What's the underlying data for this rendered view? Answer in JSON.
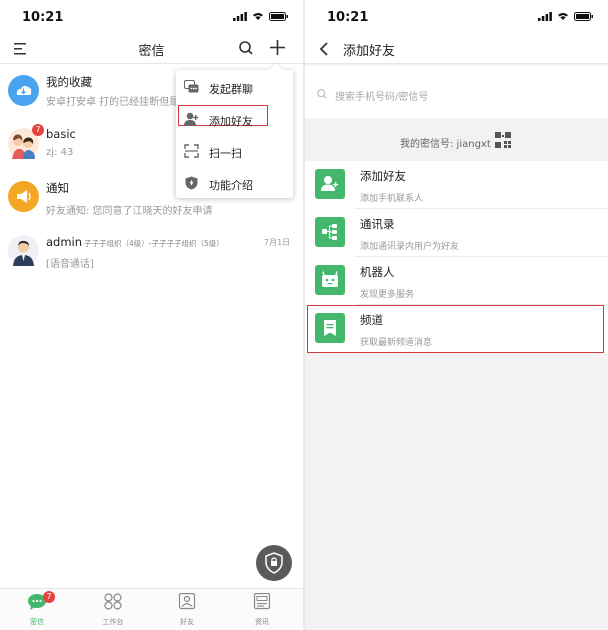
{
  "left": {
    "status": {
      "time": "10:21"
    },
    "nav": {
      "title": "密信"
    },
    "chats": [
      {
        "name": "我的收藏",
        "preview": "安卓打安卓 打的已经挂断但是",
        "meta": ""
      },
      {
        "name": "basic",
        "preview": "zj: 43",
        "meta": "",
        "badge": "7"
      },
      {
        "name": "通知",
        "preview": "好友通知: 您同意了江晓天的好友申请",
        "meta": ""
      },
      {
        "name": "admin",
        "org": "子子子组织（4级）-子子子子组织（5级）",
        "preview": "[语音通话]",
        "meta": "7月1日"
      }
    ],
    "menu": [
      {
        "label": "发起群聊",
        "icon": "group-chat-icon"
      },
      {
        "label": "添加好友",
        "icon": "add-friend-icon"
      },
      {
        "label": "扫一扫",
        "icon": "scan-icon"
      },
      {
        "label": "功能介绍",
        "icon": "feature-intro-icon"
      }
    ],
    "tabs": [
      {
        "label": "密信",
        "badge": "7"
      },
      {
        "label": "工作台"
      },
      {
        "label": "好友"
      },
      {
        "label": "资讯"
      }
    ]
  },
  "right": {
    "status": {
      "time": "10:21"
    },
    "nav": {
      "title": "添加好友"
    },
    "search": {
      "placeholder": "搜索手机号码/密信号"
    },
    "my_id": "我的密信号: jiangxt",
    "options": [
      {
        "title": "添加好友",
        "subtitle": "添加手机联系人",
        "icon": "add-contact-icon"
      },
      {
        "title": "通讯录",
        "subtitle": "添加通讯录内用户为好友",
        "icon": "contacts-icon"
      },
      {
        "title": "机器人",
        "subtitle": "发现更多服务",
        "icon": "robot-icon"
      },
      {
        "title": "频道",
        "subtitle": "获取最新频道消息",
        "icon": "channel-icon"
      }
    ]
  },
  "colors": {
    "accent_green": "#43b86c",
    "highlight_red": "#d43c3c",
    "badge_red": "#e64340",
    "notice_orange": "#f5a623",
    "favorites_blue": "#4aa3f0"
  }
}
